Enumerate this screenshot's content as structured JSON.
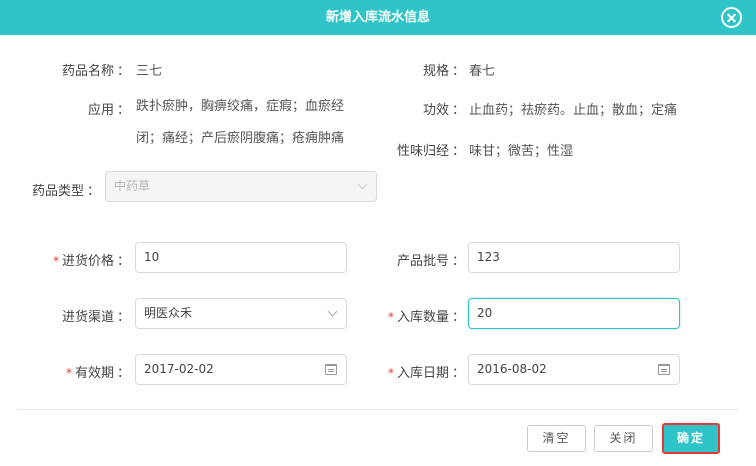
{
  "dialog": {
    "title": "新增入库流水信息"
  },
  "info": {
    "name_label": "药品名称",
    "name_value": "三七",
    "spec_label": "规格",
    "spec_value": "春七",
    "usage_label": "应用",
    "usage_line1": "跌扑瘀肿，胸痹绞痛，症瘕；血瘀经",
    "usage_line2": "闭；痛经；产后瘀阴腹痛；疮痈肿痛",
    "effect_label": "功效",
    "effect_value": "止血药；祛瘀药。止血；散血；定痛",
    "taste_label": "性味归经",
    "taste_value": "味甘；微苦；性湿",
    "type_label": "药品类型",
    "type_value": "中药草"
  },
  "form": {
    "price_label": "进货价格",
    "price_value": "10",
    "batch_label": "产品批号",
    "batch_value": "123",
    "channel_label": "进货渠道",
    "channel_value": "明医众禾",
    "qty_label": "入库数量",
    "qty_value": "20",
    "expiry_label": "有效期",
    "expiry_value": "2017-02-02",
    "date_label": "入库日期",
    "date_value": "2016-08-02",
    "colon": "：",
    "required_mark": "*"
  },
  "buttons": {
    "clear": "清空",
    "close": "关闭",
    "confirm": "确定"
  },
  "colors": {
    "accent": "#2ec4c8",
    "required": "#e4393c",
    "highlight_border": "#e53935"
  }
}
